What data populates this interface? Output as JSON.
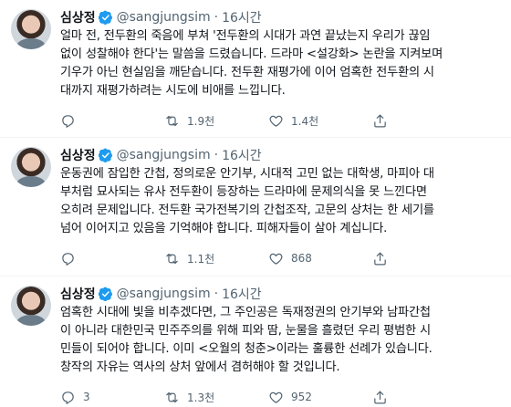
{
  "tweets": [
    {
      "name": "심상정",
      "handle": "@sangjungsim",
      "separator": "·",
      "time": "16시간",
      "text": "얼마 전, 전두환의 죽음에 부쳐 '전두환의 시대가 과연 끝났는지 우리가 끊임\n없이 성찰해야 한다'는 말씀을 드렸습니다. 드라마 <설강화> 논란을 지켜보며\n기우가 아닌 현실임을 깨닫습니다. 전두환 재평가에 이어 엄혹한 전두환의 시\n대까지 재평가하려는 시도에 비애를 느낍니다.",
      "replies": "",
      "retweets": "1.9천",
      "likes": "1.4천"
    },
    {
      "name": "심상정",
      "handle": "@sangjungsim",
      "separator": "·",
      "time": "16시간",
      "text": "운동권에 잠입한 간첩, 정의로운 안기부, 시대적 고민 없는 대학생, 마피아 대\n부처럼 묘사되는 유사 전두환이 등장하는 드라마에 문제의식을 못 느낀다면\n오히려 문제입니다. 전두환 국가전복기의 간첩조작, 고문의 상처는 한 세기를\n넘어 이어지고 있음을 기억해야 합니다. 피해자들이 살아 계십니다.",
      "replies": "",
      "retweets": "1.1천",
      "likes": "868"
    },
    {
      "name": "심상정",
      "handle": "@sangjungsim",
      "separator": "·",
      "time": "16시간",
      "text": "엄혹한 시대에 빛을 비추겠다면, 그 주인공은 독재정권의 안기부와 남파간첩\n이 아니라 대한민국 민주주의를 위해 피와 땀, 눈물을 흘렸던 우리 평범한 시\n민들이 되어야 합니다. 이미 <오월의 청춘>이라는 훌륭한 선례가 있습니다.\n창작의 자유는 역사의 상처 앞에서 겸허해야 할 것입니다.",
      "replies": "3",
      "retweets": "1.3천",
      "likes": "952"
    }
  ],
  "colors": {
    "verified": "#1d9bf0",
    "muted": "#536471",
    "text": "#0f1419"
  },
  "icons": {
    "verified": "verified-badge-icon",
    "reply": "reply-icon",
    "retweet": "retweet-icon",
    "like": "heart-icon",
    "share": "share-icon"
  }
}
